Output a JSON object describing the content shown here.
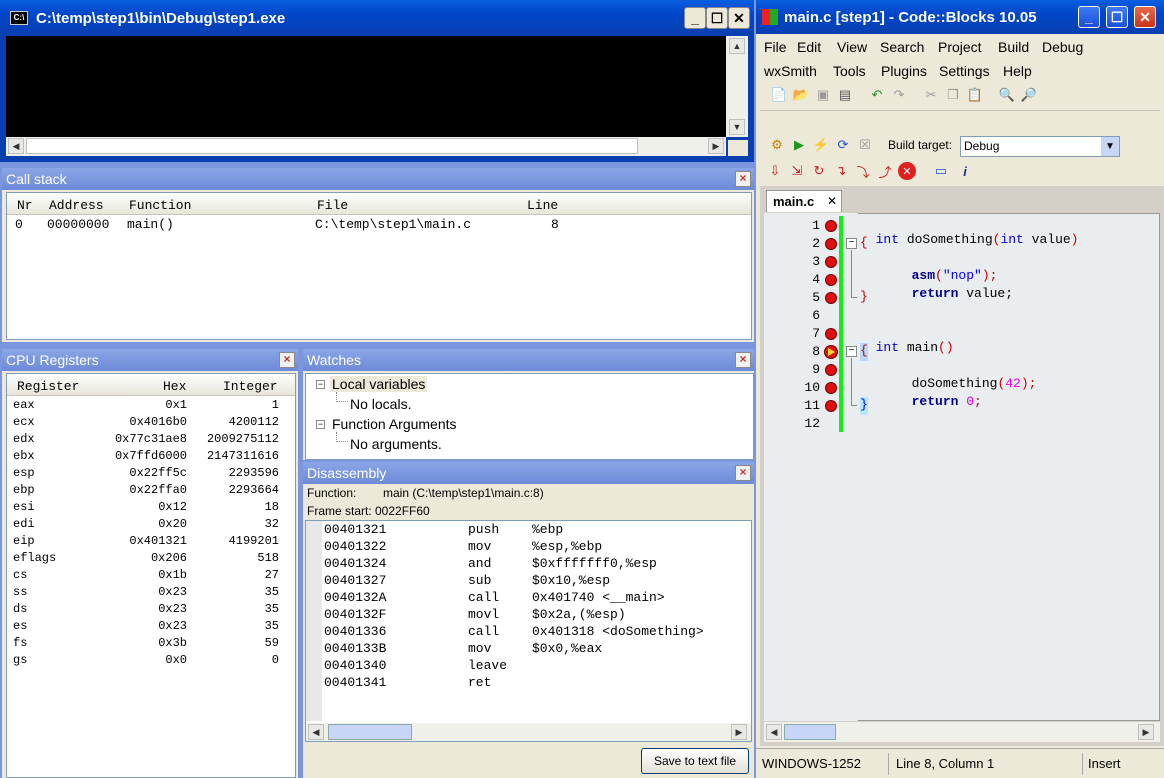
{
  "console": {
    "title": "C:\\temp\\step1\\bin\\Debug\\step1.exe"
  },
  "ide": {
    "title": "main.c [step1] - Code::Blocks 10.05",
    "menu_row1": [
      "File",
      "Edit",
      "View",
      "Search",
      "Project",
      "Build",
      "Debug"
    ],
    "menu_row2": [
      "wxSmith",
      "Tools",
      "Plugins",
      "Settings",
      "Help"
    ],
    "build_target_label": "Build target:",
    "build_target_value": "Debug",
    "editor_tab": "main.c",
    "status": {
      "encoding": "WINDOWS-1252",
      "position": "Line 8, Column 1",
      "mode": "Insert"
    }
  },
  "call_stack": {
    "title": "Call stack",
    "columns": [
      "Nr",
      "Address",
      "Function",
      "File",
      "Line"
    ],
    "rows": [
      {
        "nr": "0",
        "address": "00000000",
        "function": "main()",
        "file": "C:\\temp\\step1\\main.c",
        "line": "8"
      }
    ]
  },
  "cpu": {
    "title": "CPU Registers",
    "columns": [
      "Register",
      "Hex",
      "Integer"
    ],
    "rows": [
      {
        "reg": "eax",
        "hex": "0x1",
        "int": "1"
      },
      {
        "reg": "ecx",
        "hex": "0x4016b0",
        "int": "4200112"
      },
      {
        "reg": "edx",
        "hex": "0x77c31ae8",
        "int": "2009275112"
      },
      {
        "reg": "ebx",
        "hex": "0x7ffd6000",
        "int": "2147311616"
      },
      {
        "reg": "esp",
        "hex": "0x22ff5c",
        "int": "2293596"
      },
      {
        "reg": "ebp",
        "hex": "0x22ffa0",
        "int": "2293664"
      },
      {
        "reg": "esi",
        "hex": "0x12",
        "int": "18"
      },
      {
        "reg": "edi",
        "hex": "0x20",
        "int": "32"
      },
      {
        "reg": "eip",
        "hex": "0x401321",
        "int": "4199201"
      },
      {
        "reg": "eflags",
        "hex": "0x206",
        "int": "518"
      },
      {
        "reg": "cs",
        "hex": "0x1b",
        "int": "27"
      },
      {
        "reg": "ss",
        "hex": "0x23",
        "int": "35"
      },
      {
        "reg": "ds",
        "hex": "0x23",
        "int": "35"
      },
      {
        "reg": "es",
        "hex": "0x23",
        "int": "35"
      },
      {
        "reg": "fs",
        "hex": "0x3b",
        "int": "59"
      },
      {
        "reg": "gs",
        "hex": "0x0",
        "int": "0"
      }
    ]
  },
  "watches": {
    "title": "Watches",
    "local_vars": "Local variables",
    "no_locals": "No locals.",
    "func_args": "Function Arguments",
    "no_args": "No arguments."
  },
  "disasm": {
    "title": "Disassembly",
    "function_label": "Function:",
    "function_value": "main (C:\\temp\\step1\\main.c:8)",
    "frame_start": "Frame start: 0022FF60",
    "save_button": "Save to text file",
    "rows": [
      {
        "addr": "00401321",
        "op": "push",
        "args": "%ebp"
      },
      {
        "addr": "00401322",
        "op": "mov",
        "args": "%esp,%ebp"
      },
      {
        "addr": "00401324",
        "op": "and",
        "args": "$0xfffffff0,%esp"
      },
      {
        "addr": "00401327",
        "op": "sub",
        "args": "$0x10,%esp"
      },
      {
        "addr": "0040132A",
        "op": "call",
        "args": "0x401740 <__main>"
      },
      {
        "addr": "0040132F",
        "op": "movl",
        "args": "$0x2a,(%esp)"
      },
      {
        "addr": "00401336",
        "op": "call",
        "args": "0x401318 <doSomething>"
      },
      {
        "addr": "0040133B",
        "op": "mov",
        "args": "$0x0,%eax"
      },
      {
        "addr": "00401340",
        "op": "leave",
        "args": ""
      },
      {
        "addr": "00401341",
        "op": "ret",
        "args": ""
      }
    ]
  },
  "code": {
    "line_numbers": [
      "1",
      "2",
      "3",
      "4",
      "5",
      "6",
      "7",
      "8",
      "9",
      "10",
      "11",
      "12"
    ],
    "l1_kw": "int",
    "l1_name": " doSomething",
    "l1_p1": "(",
    "l1_kw2": "int",
    "l1_rest": " value",
    "l1_p2": ")",
    "l2": "{",
    "l3_fn": "asm",
    "l3_p1": "(",
    "l3_str": "\"nop\"",
    "l3_p2": ");",
    "l4_kw": "return",
    "l4_rest": " value;",
    "l5": "}",
    "l7_kw": "int",
    "l7_name": " main",
    "l7_p": "()",
    "l8": "{",
    "l9_fn": "doSomething",
    "l9_p1": "(",
    "l9_num": "42",
    "l9_p2": ");",
    "l10_kw": "return",
    "l10_num": " 0",
    "l10_p": ";",
    "l11": "}"
  }
}
